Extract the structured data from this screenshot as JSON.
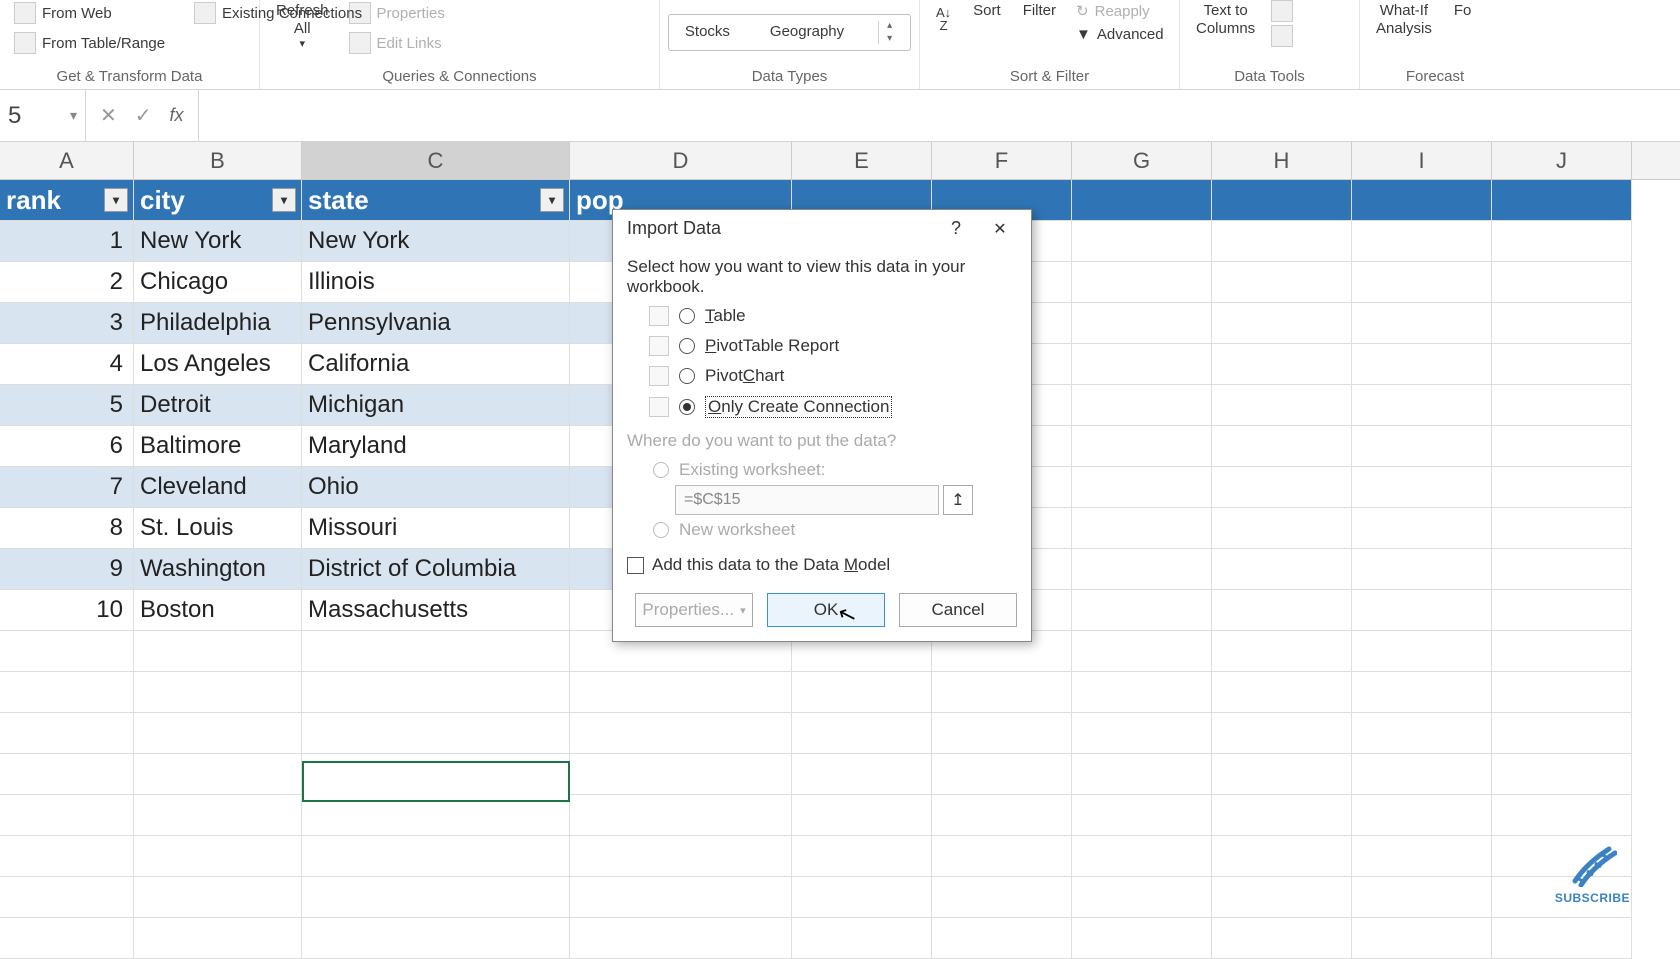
{
  "ribbon": {
    "getTransform": {
      "fromWeb": "From Web",
      "existingConnections": "Existing Connections",
      "fromTableRange": "From Table/Range",
      "label": "Get & Transform Data"
    },
    "queries": {
      "refreshAll": "Refresh\nAll",
      "properties": "Properties",
      "editLinks": "Edit Links",
      "label": "Queries & Connections"
    },
    "dataTypes": {
      "stocks": "Stocks",
      "geography": "Geography",
      "label": "Data Types"
    },
    "sortFilter": {
      "sort": "Sort",
      "filter": "Filter",
      "reapply": "Reapply",
      "advanced": "Advanced",
      "label": "Sort & Filter"
    },
    "dataTools": {
      "textToColumns": "Text to\nColumns",
      "label": "Data Tools"
    },
    "forecast": {
      "whatIf": "What-If\nAnalysis",
      "label": "Forecast"
    }
  },
  "nameBox": "5",
  "columns": [
    "A",
    "B",
    "C",
    "D",
    "E",
    "F",
    "G",
    "H",
    "I",
    "J"
  ],
  "tableHeaders": {
    "rank": "rank",
    "city": "city",
    "state": "state",
    "pop": "pop"
  },
  "rows": [
    {
      "rank": "1",
      "city": "New York",
      "state": "New York"
    },
    {
      "rank": "2",
      "city": "Chicago",
      "state": "Illinois"
    },
    {
      "rank": "3",
      "city": "Philadelphia",
      "state": "Pennsylvania"
    },
    {
      "rank": "4",
      "city": "Los Angeles",
      "state": "California"
    },
    {
      "rank": "5",
      "city": "Detroit",
      "state": "Michigan"
    },
    {
      "rank": "6",
      "city": "Baltimore",
      "state": "Maryland"
    },
    {
      "rank": "7",
      "city": "Cleveland",
      "state": "Ohio"
    },
    {
      "rank": "8",
      "city": "St. Louis",
      "state": "Missouri"
    },
    {
      "rank": "9",
      "city": "Washington",
      "state": "District of Columbia"
    },
    {
      "rank": "10",
      "city": "Boston",
      "state": "Massachusetts"
    }
  ],
  "dialog": {
    "title": "Import Data",
    "prompt": "Select how you want to view this data in your workbook.",
    "optTable": "Table",
    "optPivotTable": "PivotTable Report",
    "optPivotChart": "PivotChart",
    "optConnection": "Only Create Connection",
    "wherePrompt": "Where do you want to put the data?",
    "existing": "Existing worksheet:",
    "range": "=$C$15",
    "newSheet": "New worksheet",
    "dataModel": "Add this data to the Data Model",
    "properties": "Properties...",
    "ok": "OK",
    "cancel": "Cancel"
  },
  "subscribe": "SUBSCRIBE"
}
